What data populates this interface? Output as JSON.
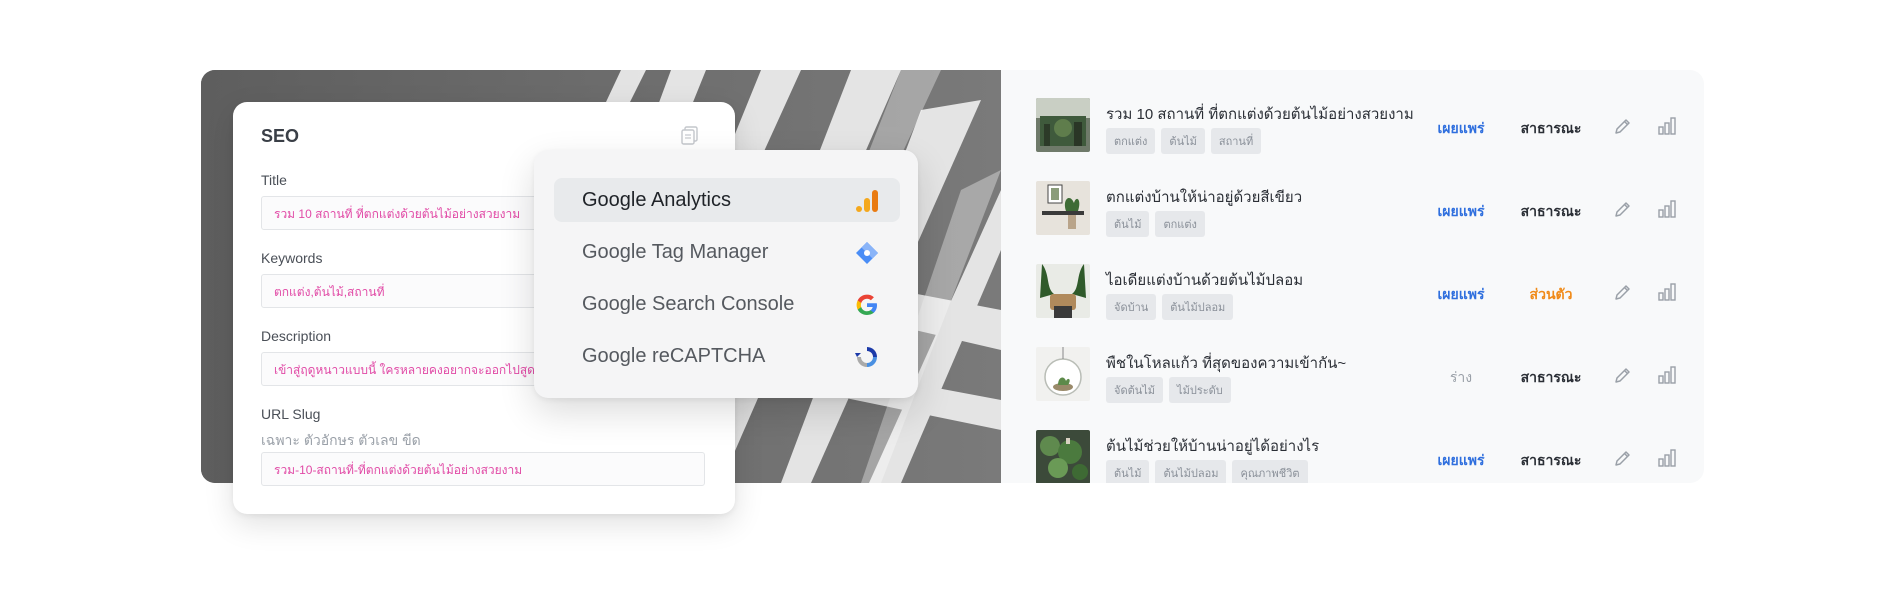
{
  "seo": {
    "title": "SEO",
    "fields": [
      {
        "label": "Title",
        "value": "รวม 10 สถานที่ ที่ตกแต่งด้วยต้นไม้อย่างสวยงาม"
      },
      {
        "label": "Keywords",
        "value": "ตกแต่ง,ต้นไม้,สถานที่"
      },
      {
        "label": "Description",
        "value": "เข้าสู่ฤดูหนาวแบบนี้ ใครหลายคงอยากจะออกไปสูดอ"
      },
      {
        "label": "URL Slug",
        "hint": "เฉพาะ ตัวอักษร ตัวเลข ขีด",
        "value": "รวม-10-สถานที่-ที่ตกแต่งด้วยต้นไม้อย่างสวยงาม"
      }
    ]
  },
  "integrations": {
    "items": [
      {
        "label": "Google Analytics",
        "icon": "analytics-bars-icon",
        "active": true
      },
      {
        "label": "Google Tag Manager",
        "icon": "tag-manager-icon",
        "active": false
      },
      {
        "label": "Google Search Console",
        "icon": "google-g-icon",
        "active": false
      },
      {
        "label": "Google reCAPTCHA",
        "icon": "recaptcha-icon",
        "active": false
      }
    ]
  },
  "posts": [
    {
      "title": "รวม 10 สถานที่ ที่ตกแต่งด้วยต้นไม้อย่างสวยงาม",
      "tags": [
        "ตกแต่ง",
        "ต้นไม้",
        "สถานที่"
      ],
      "status": "เผยแพร่",
      "visibility": "สาธารณะ"
    },
    {
      "title": "ตกแต่งบ้านให้น่าอยู่ด้วยสีเขียว",
      "tags": [
        "ต้นไม้",
        "ตกแต่ง"
      ],
      "status": "เผยแพร่",
      "visibility": "สาธารณะ"
    },
    {
      "title": "ไอเดียแต่งบ้านด้วยต้นไม้ปลอม",
      "tags": [
        "จัดบ้าน",
        "ต้นไม้ปลอม"
      ],
      "status": "เผยแพร่",
      "visibility": "ส่วนตัว"
    },
    {
      "title": "พืชในโหลแก้ว ที่สุดของความเข้ากัน~",
      "tags": [
        "จัดต้นไม้",
        "ไม้ประดับ"
      ],
      "status": "ร่าง",
      "visibility": "สาธารณะ"
    },
    {
      "title": "ต้นไม้ช่วยให้บ้านน่าอยู่ได้อย่างไร",
      "tags": [
        "ต้นไม้",
        "ต้นไม้ปลอม",
        "คุณภาพชีวิต"
      ],
      "status": "เผยแพร่",
      "visibility": "สาธารณะ"
    }
  ],
  "colors": {
    "published": "#2f6fde",
    "draft": "#9aa0a8",
    "private": "#f08a18",
    "keyword_text": "#e14aa6"
  }
}
